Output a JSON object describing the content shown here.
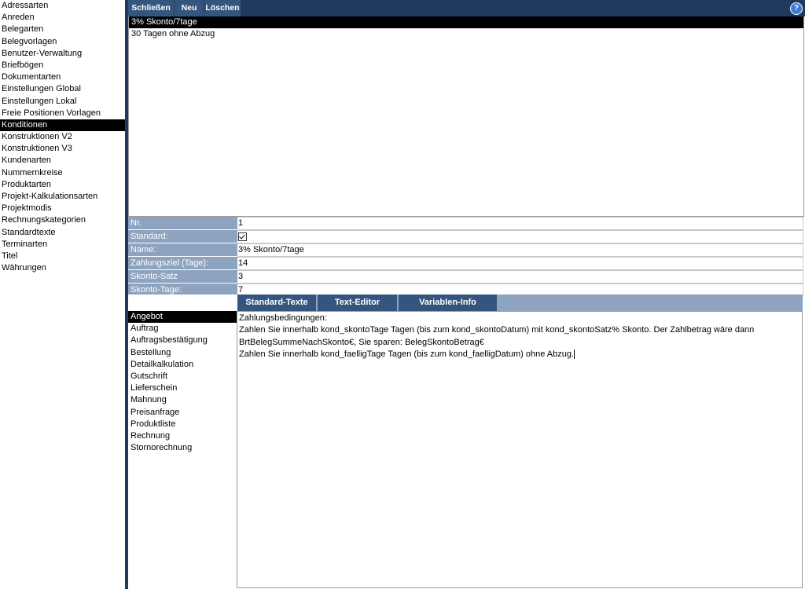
{
  "leftnav": {
    "items": [
      "Adressarten",
      "Anreden",
      "Belegarten",
      "Belegvorlagen",
      "Benutzer-Verwaltung",
      "Briefbögen",
      "Dokumentarten",
      "Einstellungen Global",
      "Einstellungen Lokal",
      "Freie Positionen Vorlagen",
      "Konditionen",
      "Konstruktionen V2",
      "Konstruktionen V3",
      "Kundenarten",
      "Nummernkreise",
      "Produktarten",
      "Projekt-Kalkulationsarten",
      "Projektmodis",
      "Rechnungskategorien",
      "Standardtexte",
      "Terminarten",
      "Titel",
      "Währungen"
    ],
    "selected": "Konditionen"
  },
  "toolbar": {
    "close_label": "Schließen",
    "new_label": "Neu",
    "delete_label": "Löschen",
    "help_label": "?"
  },
  "conditions_list": {
    "rows": [
      "3% Skonto/7tage",
      "30 Tagen ohne Abzug"
    ],
    "selected": "3% Skonto/7tage"
  },
  "form": {
    "nr_label": "Nr.",
    "nr_value": "1",
    "standard_label": "Standard:",
    "standard_checked": true,
    "name_label": "Name:",
    "name_value": "3% Skonto/7tage",
    "payment_term_label": "Zahlungsziel (Tage):",
    "payment_term_value": "14",
    "discount_rate_label": "Skonto-Satz",
    "discount_rate_value": "3",
    "discount_days_label": "Skonto-Tage:",
    "discount_days_value": "7"
  },
  "tabs": [
    "Standard-Texte",
    "Text-Editor",
    "Variablen-Info"
  ],
  "doctypes": {
    "items": [
      "Angebot",
      "Auftrag",
      "Auftragsbestätigung",
      "Bestellung",
      "Detailkalkulation",
      "Gutschrift",
      "Lieferschein",
      "Mahnung",
      "Preisanfrage",
      "Produktliste",
      "Rechnung",
      "Stornorechnung"
    ],
    "selected": "Angebot"
  },
  "text_content": {
    "lines": [
      "Zahlungsbedingungen:",
      "Zahlen Sie innerhalb kond_skontoTage Tagen (bis zum kond_skontoDatum) mit kond_skontoSatz% Skonto. Der Zahlbetrag wäre dann",
      "BrtBelegSummeNachSkonto€, Sie sparen: BelegSkontoBetrag€",
      "Zahlen Sie innerhalb kond_faelligTage Tagen (bis zum kond_faelligDatum) ohne Abzug."
    ]
  }
}
